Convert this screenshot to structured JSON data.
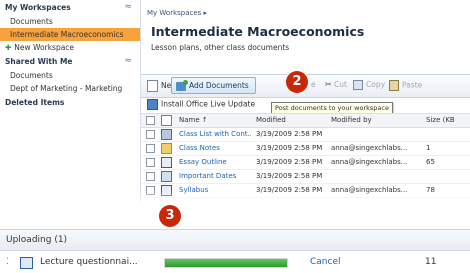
{
  "sidebar": {
    "my_workspaces": {
      "label": "My Workspaces",
      "items": [
        {
          "label": "Documents"
        },
        {
          "label": "Intermediate Macroeconomics"
        }
      ]
    },
    "new_workspace_label": "New Workspace",
    "shared_with_me": {
      "label": "Shared With Me",
      "items": [
        {
          "label": "Documents"
        },
        {
          "label": "Dept of Marketing - Marketing"
        }
      ]
    },
    "deleted_items_label": "Deleted Items",
    "selected_color": "#f7a23c"
  },
  "main": {
    "breadcrumb": "My Workspaces ▸",
    "title": "Intermediate Macroeconomics",
    "subtitle": "Lesson plans, other class documents"
  },
  "toolbar": {
    "new_label": "New",
    "add_documents_label": "Add Documents",
    "delete_label": "e",
    "cut_label": "Cut",
    "copy_label": "Copy",
    "paste_label": "Paste",
    "install_label": "Install Office Live Update",
    "tooltip": "Post documents to your workspace"
  },
  "callouts": {
    "two": "2",
    "three": "3",
    "color": "#c8270a"
  },
  "table": {
    "headers": {
      "name": "Name ↑",
      "modified": "Modified",
      "modified_by": "Modified by",
      "size": "Size (KB"
    },
    "rows": [
      {
        "icon": "image-file-icon",
        "name": "Class List with Cont...",
        "modified": "3/19/2009 2:58 PM",
        "by": "",
        "size": ""
      },
      {
        "icon": "folder-icon",
        "name": "Class Notes",
        "modified": "3/19/2009 2:58 PM",
        "by": "anna@singexchlabs...",
        "size": "1"
      },
      {
        "icon": "document-icon",
        "name": "Essay Outline",
        "modified": "3/19/2009 2:58 PM",
        "by": "anna@singexchlabs...",
        "size": "65"
      },
      {
        "icon": "list-icon",
        "name": "Important Dates",
        "modified": "3/19/2009 2:58 PM",
        "by": "",
        "size": ""
      },
      {
        "icon": "document-icon",
        "name": "Syllabus",
        "modified": "3/19/2009 2:58 PM",
        "by": "anna@singexchlabs...",
        "size": "78"
      }
    ]
  },
  "upload": {
    "header": "Uploading (1)",
    "file_name": "Lecture questionnai...",
    "progress": 1.0,
    "cancel_label": "Cancel",
    "count": "11",
    "progress_color": "#3aa83a"
  }
}
